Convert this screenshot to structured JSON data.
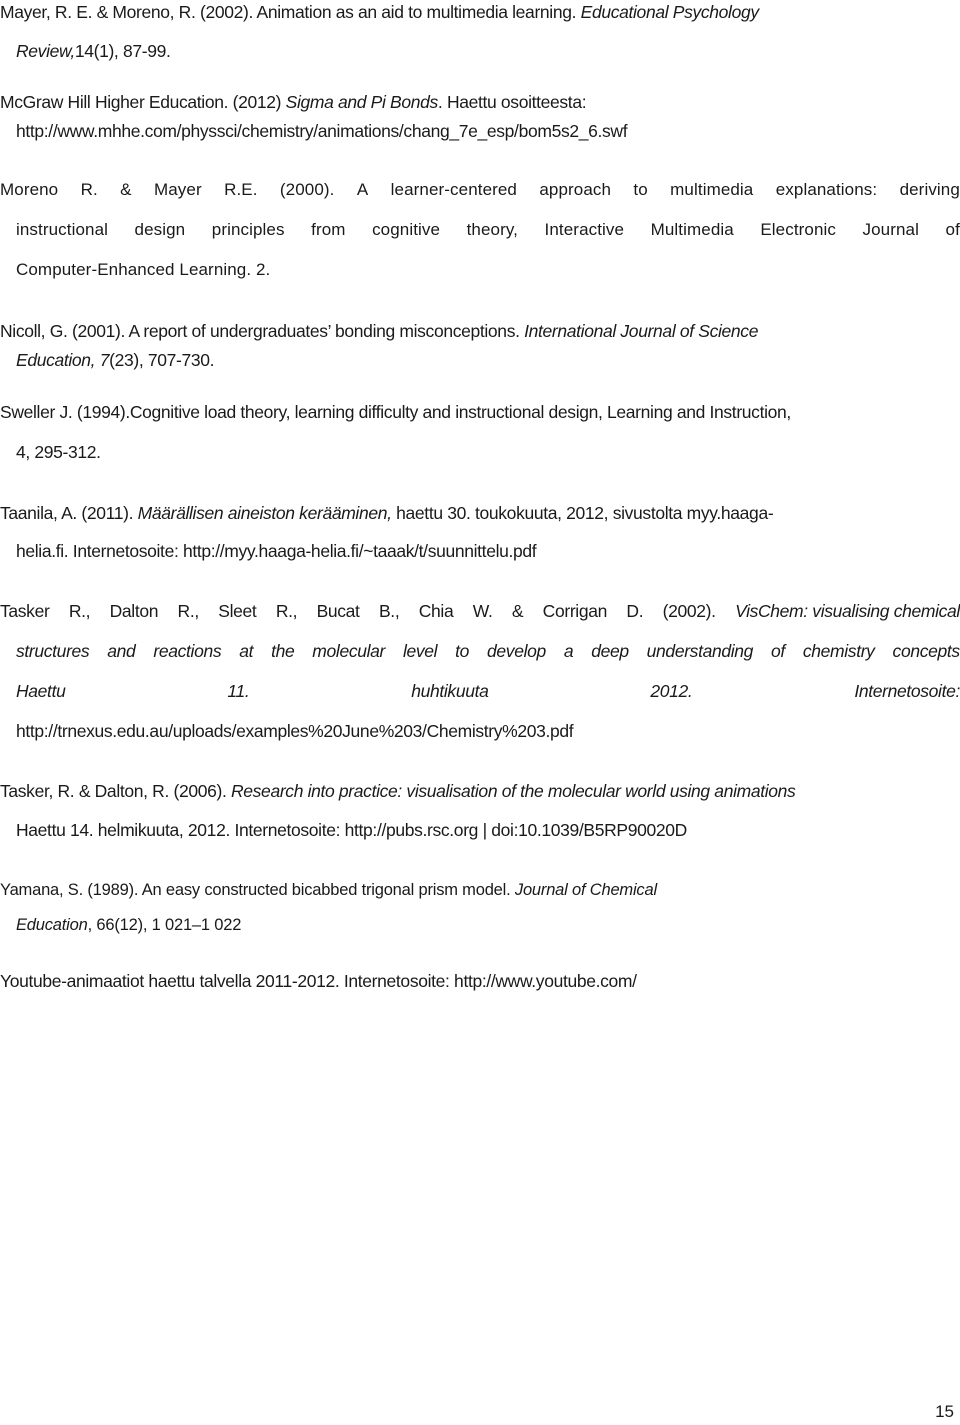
{
  "references": [
    {
      "id": "mayer-moreno-2002",
      "lines": [
        {
          "pre": "Mayer, R. E. & Moreno, R. (2002). Animation as an aid to multimedia learning. ",
          "italic": "Educational Psychology",
          "post": ""
        },
        {
          "pre": "",
          "italic": "Review,",
          "post": "14(1), 87-99."
        }
      ]
    },
    {
      "id": "mcgraw-hill-2012",
      "lines": [
        {
          "pre": "McGraw Hill Higher Education. (2012) ",
          "italic": "Sigma and Pi Bonds",
          "post": ". Haettu osoitteesta:"
        },
        {
          "pre": "http://www.mhhe.com/physsci/chemistry/animations/chang_7e_esp/bom5s2_6.swf",
          "italic": "",
          "post": ""
        }
      ]
    },
    {
      "id": "moreno-mayer-2000",
      "lines": [
        {
          "words": [
            "Moreno",
            "R.",
            "&",
            "Mayer",
            "R.E.",
            "(2000).",
            "A",
            "learner-centered",
            "approach",
            "to",
            "multimedia",
            "explanations:",
            "deriving"
          ]
        },
        {
          "words": [
            "instructional",
            "design",
            "principles",
            "from",
            "cognitive",
            "theory,",
            "Interactive",
            "Multimedia",
            "Electronic",
            "Journal",
            "of"
          ]
        },
        {
          "pre": "Computer-Enhanced Learning. 2.",
          "italic": "",
          "post": ""
        }
      ]
    },
    {
      "id": "nicoll-2001",
      "lines": [
        {
          "pre": "Nicoll, G. (2001). A report of undergraduates’ bonding misconceptions. ",
          "italic": "International Journal of Science",
          "post": ""
        },
        {
          "pre": "",
          "italic": "Education, 7",
          "post": "(23), 707-730."
        }
      ]
    },
    {
      "id": "sweller-1994",
      "lines": [
        {
          "pre": "Sweller J. (1994).Cognitive load theory, learning difficulty and instructional design, Learning and Instruction,",
          "italic": "",
          "post": ""
        },
        {
          "pre": "4, 295-312.",
          "italic": "",
          "post": ""
        }
      ]
    },
    {
      "id": "taanila-2011",
      "lines": [
        {
          "pre": "Taanila, A. (2011).  ",
          "italic": "Määrällisen aineiston kerääminen,",
          "post": " haettu 30. toukokuuta, 2012, sivustolta myy.haaga-"
        },
        {
          "pre": "helia.fi. Internetosoite: http://myy.haaga-helia.fi/~taaak/t/suunnittelu.pdf",
          "italic": "",
          "post": ""
        }
      ]
    },
    {
      "id": "tasker-2002",
      "lines": [
        {
          "words": [
            "Tasker",
            "R.,",
            "Dalton",
            "R.,",
            "Sleet",
            "R.,",
            "Bucat",
            "B.,",
            "Chia",
            "W.",
            "&",
            "Corrigan",
            "D.",
            "(2002).",
            "VisChem: visualising chemical"
          ],
          "italic_last": true
        },
        {
          "words": [
            "structures",
            "and",
            "reactions",
            "at",
            "the",
            "molecular",
            "level",
            "to",
            "develop",
            "a",
            "deep",
            "understanding",
            "of",
            "chemistry",
            "concepts"
          ],
          "italic_all": true
        },
        {
          "words": [
            "Haettu",
            "11.",
            "huhtikuuta",
            "2012.",
            "Internetosoite:"
          ],
          "italic_all": true
        },
        {
          "pre": "http://trnexus.edu.au/uploads/examples%20June%203/Chemistry%203.pdf",
          "italic": "",
          "post": ""
        }
      ]
    },
    {
      "id": "tasker-dalton-2006",
      "lines": [
        {
          "pre": "Tasker, R. & Dalton, R. (2006).  ",
          "italic": "Research into practice: visualisation of the molecular world using animations",
          "post": ""
        },
        {
          "pre": "Haettu 14. helmikuuta, 2012. Internetosoite: http://pubs.rsc.org | doi:10.1039/B5RP90020D",
          "italic": "",
          "post": ""
        }
      ]
    },
    {
      "id": "yamana-1989",
      "lines": [
        {
          "pre": "Yamana, S. (1989).  An easy constructed bicabbed trigonal prism model. ",
          "italic": "Journal of Chemical",
          "post": ""
        },
        {
          "pre": "",
          "italic": "Education",
          "post": ", 66(12), 1 021–1 022"
        }
      ]
    },
    {
      "id": "youtube",
      "lines": [
        {
          "pre": "Youtube-animaatiot haettu talvella 2011-2012. Internetosoite: http://www.youtube.com/",
          "italic": "",
          "post": ""
        }
      ]
    }
  ],
  "page_number": "15"
}
